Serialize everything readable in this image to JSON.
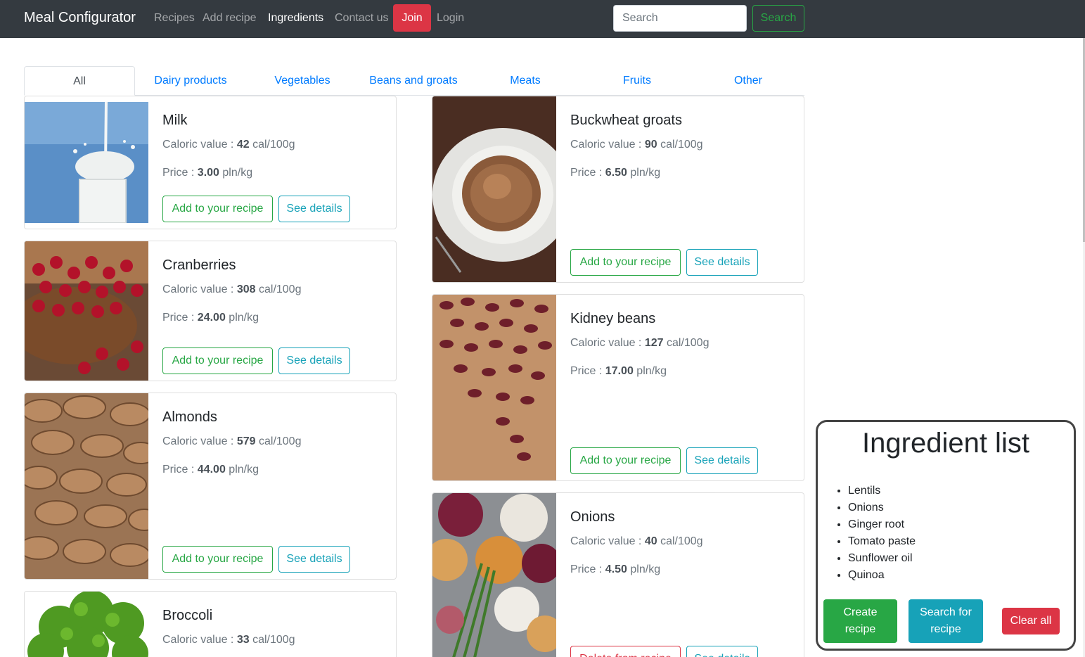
{
  "navbar": {
    "brand": "Meal Configurator",
    "links": [
      "Recipes",
      "Add recipe",
      "Ingredients",
      "Contact us"
    ],
    "join": "Join",
    "login": "Login",
    "search_placeholder": "Search",
    "search_button": "Search",
    "colors": {
      "background": "#343a40",
      "join": "#dc3545",
      "search": "#28a745"
    }
  },
  "tabs": [
    "All",
    "Dairy products",
    "Vegetables",
    "Beans and groats",
    "Meats",
    "Fruits",
    "Other"
  ],
  "cards": {
    "milk": {
      "name": "Milk",
      "cal_label": "Caloric value :",
      "cal": "42",
      "cal_unit": "cal/100g",
      "price_label": "Price :",
      "price": "3.00",
      "price_unit": "pln/kg",
      "add": "Add to your recipe",
      "details": "See details",
      "image": "milk-glass-photo"
    },
    "cranberries": {
      "name": "Cranberries",
      "cal_label": "Caloric value :",
      "cal": "308",
      "cal_unit": "cal/100g",
      "price_label": "Price :",
      "price": "24.00",
      "price_unit": "pln/kg",
      "add": "Add to your recipe",
      "details": "See details",
      "image": "cranberries-bowl-photo"
    },
    "almonds": {
      "name": "Almonds",
      "cal_label": "Caloric value :",
      "cal": "579",
      "cal_unit": "cal/100g",
      "price_label": "Price :",
      "price": "44.00",
      "price_unit": "pln/kg",
      "add": "Add to your recipe",
      "details": "See details",
      "image": "almonds-photo"
    },
    "broccoli": {
      "name": "Broccoli",
      "cal_label": "Caloric value :",
      "cal": "33",
      "cal_unit": "cal/100g",
      "image": "broccoli-photo"
    },
    "buckwheat": {
      "name": "Buckwheat groats",
      "cal_label": "Caloric value :",
      "cal": "90",
      "cal_unit": "cal/100g",
      "price_label": "Price :",
      "price": "6.50",
      "price_unit": "pln/kg",
      "add": "Add to your recipe",
      "details": "See details",
      "image": "buckwheat-plate-photo"
    },
    "kidney": {
      "name": "Kidney beans",
      "cal_label": "Caloric value :",
      "cal": "127",
      "cal_unit": "cal/100g",
      "price_label": "Price :",
      "price": "17.00",
      "price_unit": "pln/kg",
      "add": "Add to your recipe",
      "details": "See details",
      "image": "kidney-beans-photo"
    },
    "onions": {
      "name": "Onions",
      "cal_label": "Caloric value :",
      "cal": "40",
      "cal_unit": "cal/100g",
      "price_label": "Price :",
      "price": "4.50",
      "price_unit": "pln/kg",
      "delete": "Delete from recipe",
      "details": "See details",
      "image": "onions-photo"
    }
  },
  "ingredient_list": {
    "title": "Ingredient list",
    "items": [
      "Lentils",
      "Onions",
      "Ginger root",
      "Tomato paste",
      "Sunflower oil",
      "Quinoa"
    ],
    "create_line1": "Create",
    "create_line2": "recipe",
    "search_line1": "Search for",
    "search_line2": "recipe",
    "clear": "Clear all"
  }
}
